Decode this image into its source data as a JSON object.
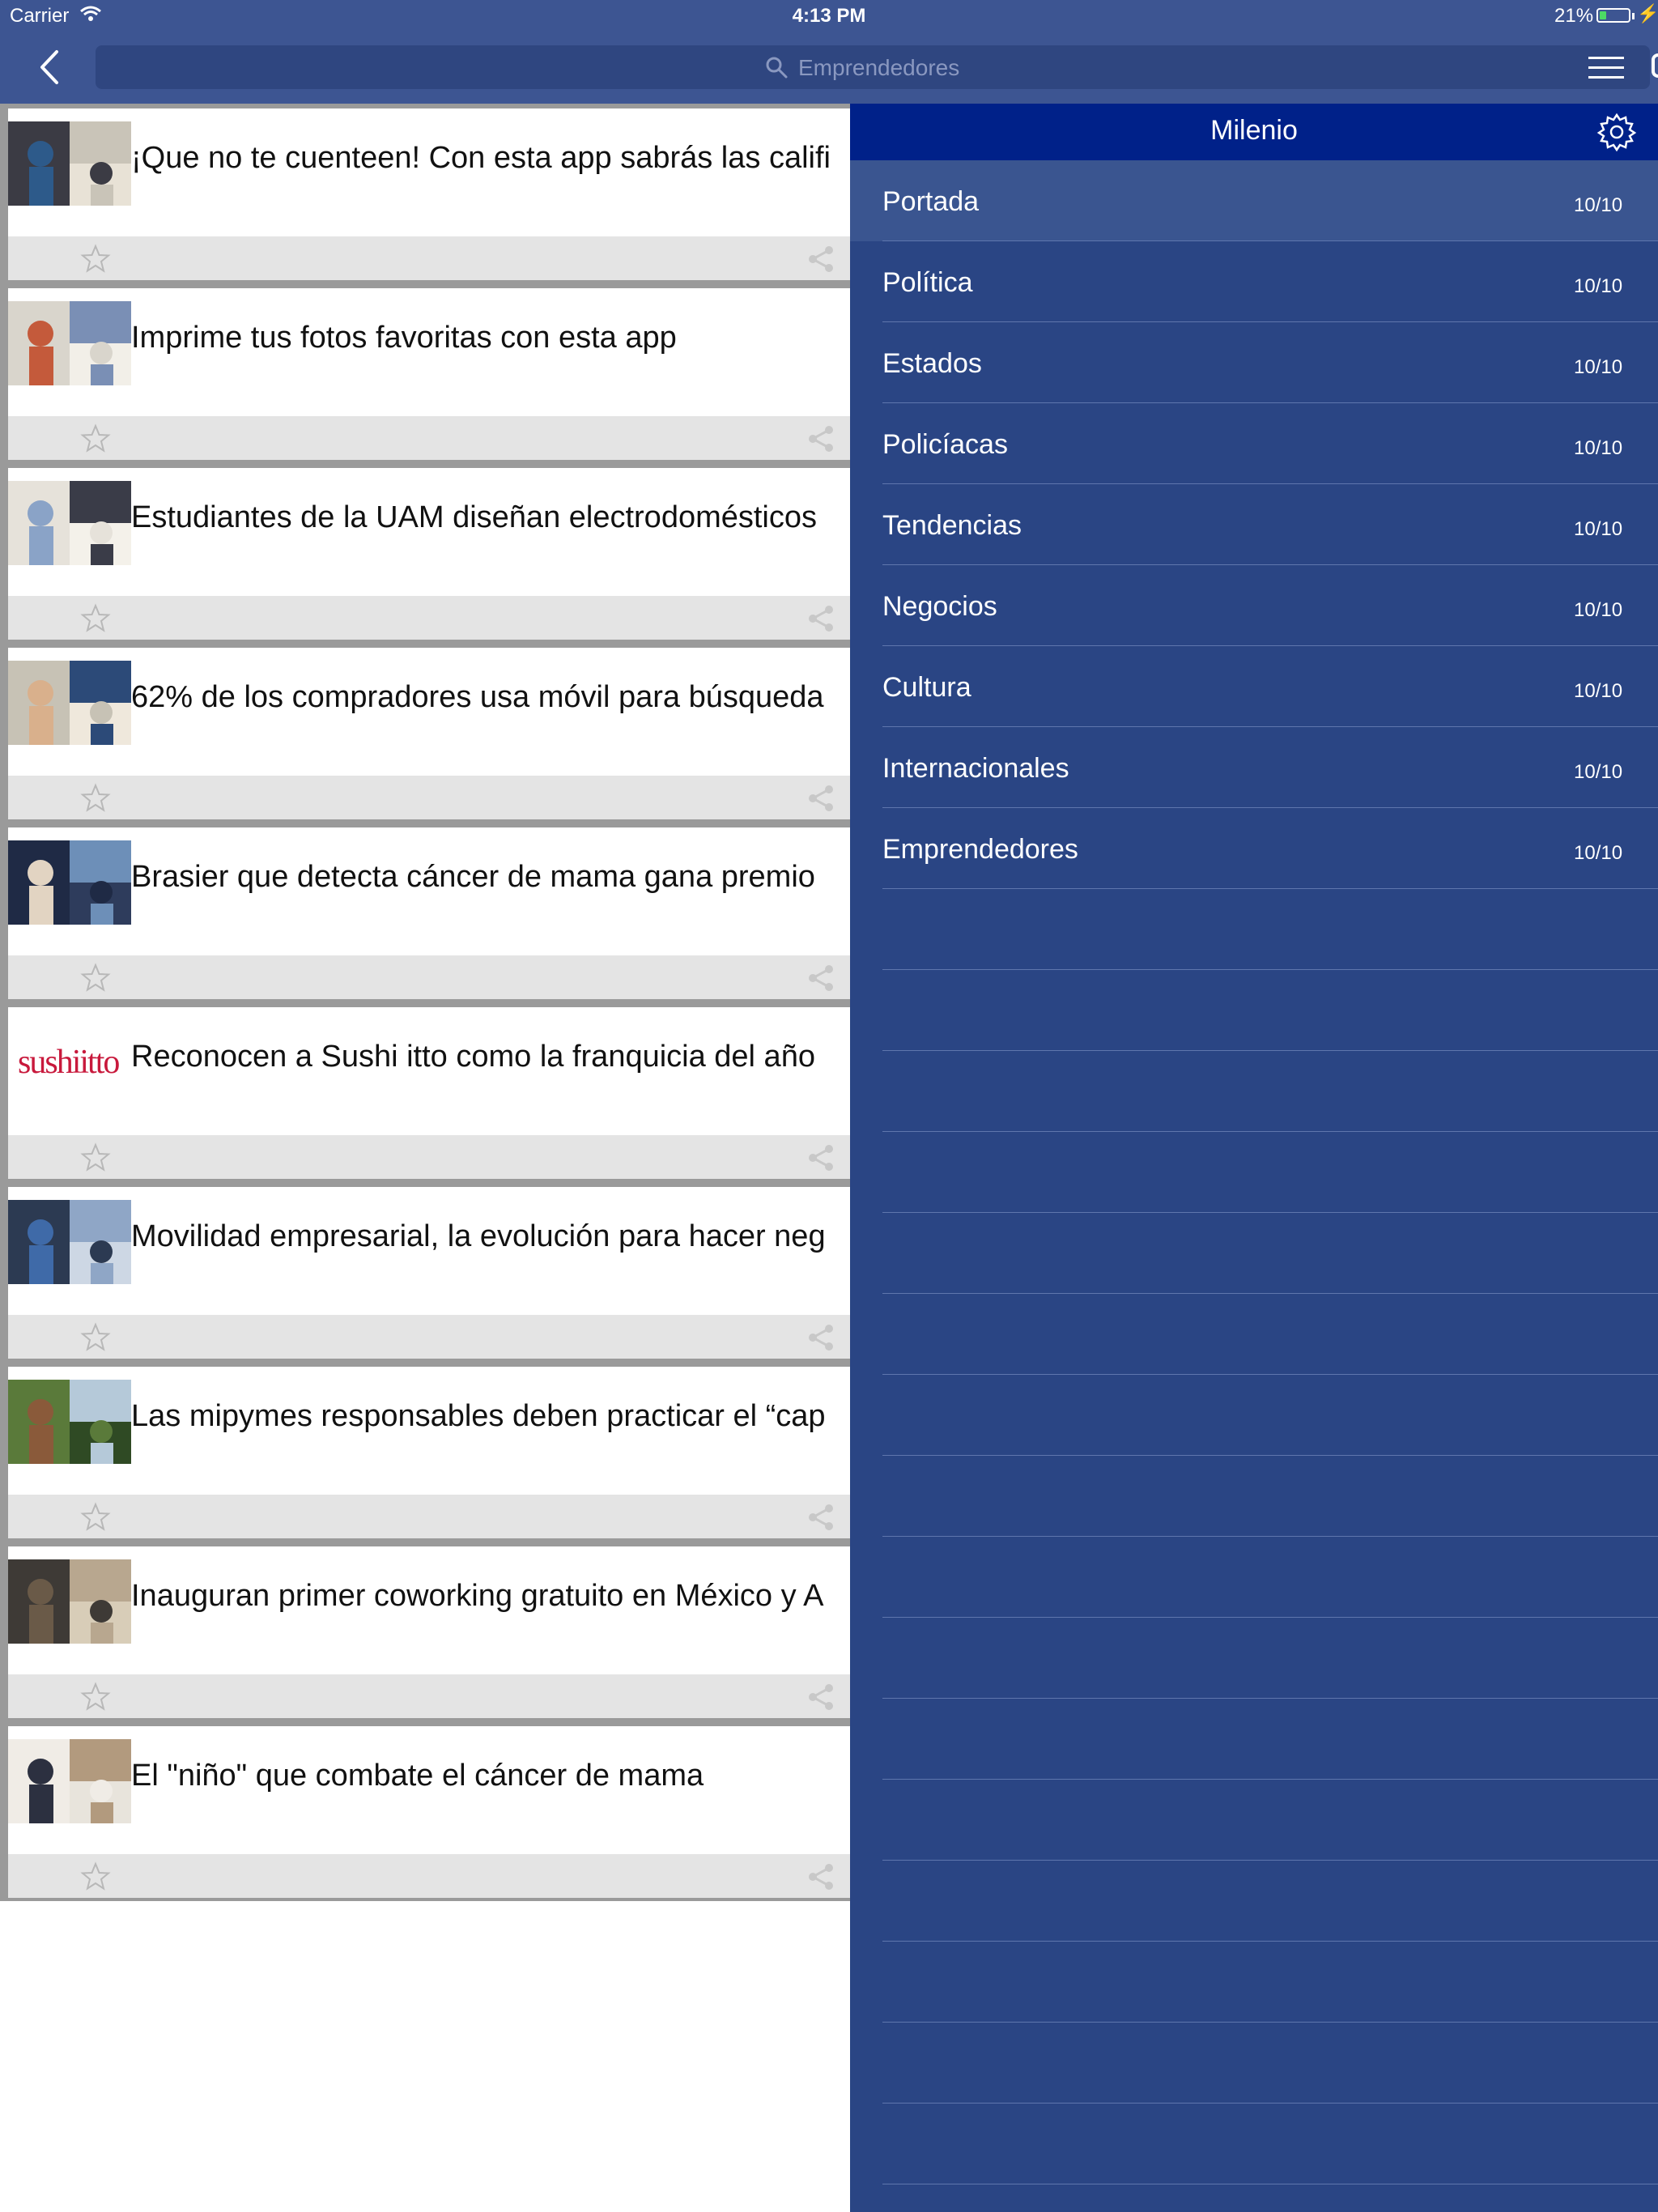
{
  "status_bar": {
    "carrier": "Carrier",
    "time": "4:13 PM",
    "battery_percent": "21%",
    "battery_level": 0.21
  },
  "nav": {
    "search_placeholder": "Emprendedores",
    "back_icon": "chevron-left-icon",
    "menu_icon": "hamburger-menu-icon"
  },
  "feed": {
    "items": [
      {
        "title": "¡Que no te cuenteen! Con esta app sabrás las califi"
      },
      {
        "title": "Imprime tus fotos favoritas con esta app"
      },
      {
        "title": "Estudiantes de la UAM diseñan electrodomésticos"
      },
      {
        "title": "62% de los compradores usa móvil para búsqueda"
      },
      {
        "title": "Brasier que detecta cáncer de mama gana premio"
      },
      {
        "title": "Reconocen a Sushi itto como la franquicia del año",
        "thumb_text": "sushiitto"
      },
      {
        "title": "Movilidad empresarial, la evolución para hacer neg"
      },
      {
        "title": "Las mipymes responsables deben practicar el “cap"
      },
      {
        "title": "Inauguran primer coworking gratuito en México y A"
      },
      {
        "title": "El \"niño\" que combate el cáncer de mama"
      }
    ]
  },
  "panel": {
    "title": "Milenio",
    "sections": [
      {
        "label": "Portada",
        "count": "10/10"
      },
      {
        "label": "Política",
        "count": "10/10"
      },
      {
        "label": "Estados",
        "count": "10/10"
      },
      {
        "label": "Policíacas",
        "count": "10/10"
      },
      {
        "label": "Tendencias",
        "count": "10/10"
      },
      {
        "label": "Negocios",
        "count": "10/10"
      },
      {
        "label": "Cultura",
        "count": "10/10"
      },
      {
        "label": "Internacionales",
        "count": "10/10"
      },
      {
        "label": "Emprendedores",
        "count": "10/10"
      }
    ],
    "selected_section": "Portada"
  },
  "colors": {
    "nav_bar": "#3d5592",
    "panel_bg": "#2a4584",
    "panel_header": "#002189",
    "feed_separator": "#9a9a9a",
    "action_bar": "#e4e4e4"
  }
}
